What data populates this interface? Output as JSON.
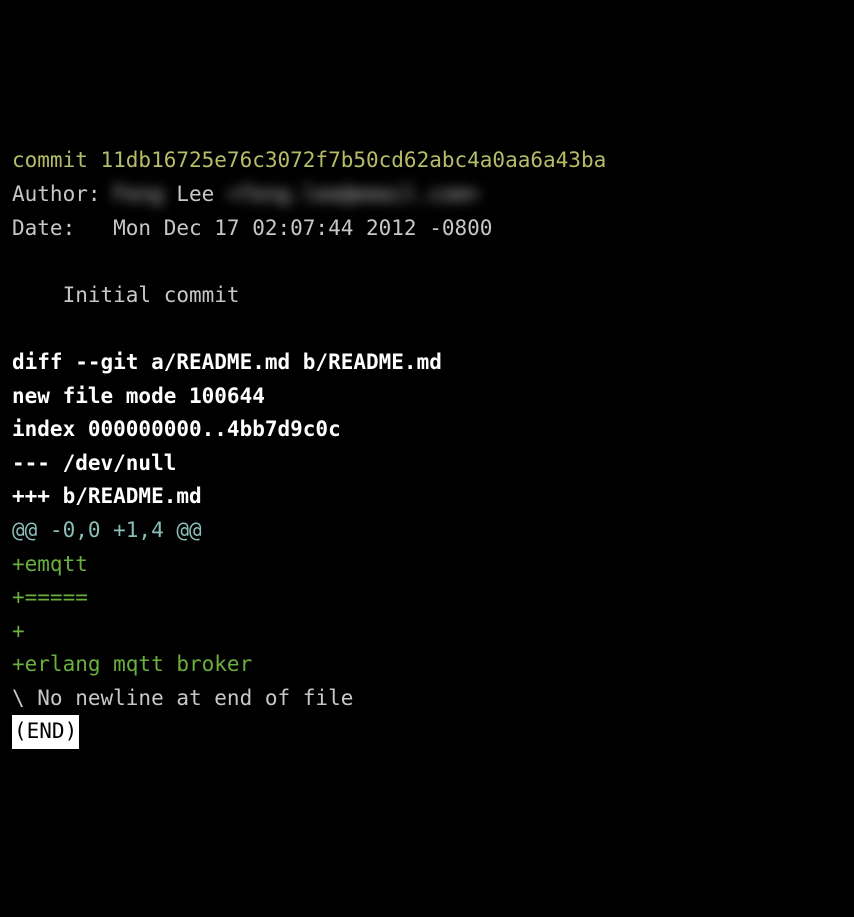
{
  "commit": {
    "hash_line": "commit 11db16725e76c3072f7b50cd62abc4a0aa6a43ba",
    "author_label": "Author: ",
    "author_name_first": "Feng",
    "author_name_last": " Lee ",
    "author_email": "<feng.lee@email.com>",
    "date_line": "Date:   Mon Dec 17 02:07:44 2012 -0800",
    "message": "    Initial commit"
  },
  "diff": {
    "header1": "diff --git a/README.md b/README.md",
    "header2": "new file mode 100644",
    "header3": "index 000000000..4bb7d9c0c",
    "header4": "--- /dev/null",
    "header5": "+++ b/README.md",
    "hunk": "@@ -0,0 +1,4 @@",
    "added1": "+emqtt",
    "added2": "+=====",
    "added3": "+",
    "added4": "+erlang mqtt broker",
    "nonewline": "\\ No newline at end of file"
  },
  "pager": {
    "end": "(END)"
  }
}
